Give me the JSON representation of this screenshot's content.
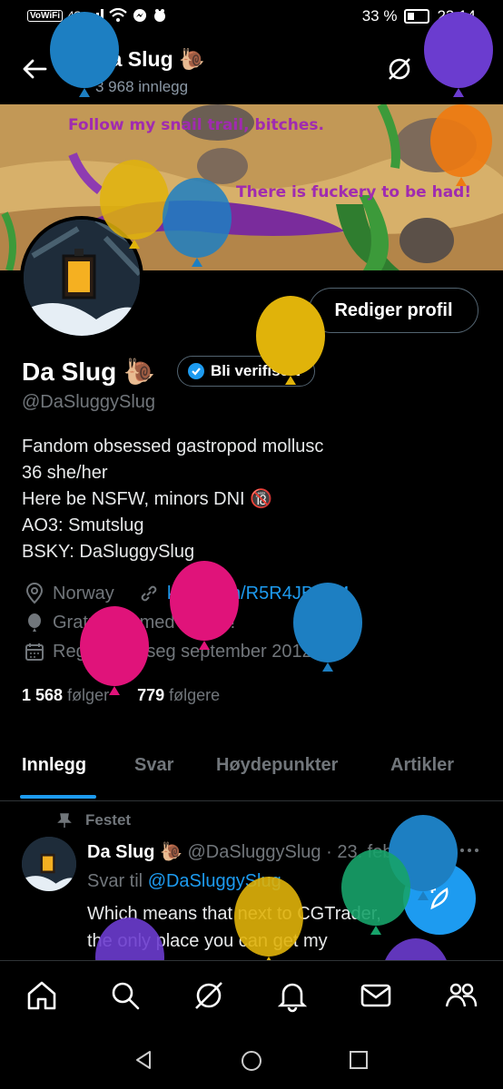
{
  "status_bar": {
    "vowifi": "VoWiFi",
    "network": "4G",
    "battery": "33 %",
    "time": "23:14"
  },
  "header": {
    "name": "Da Slug",
    "emoji": "🐌",
    "post_count": "3 968 innlegg"
  },
  "banner": {
    "text_top": "Follow my snail trail, bitches.",
    "text_bottom": "There is fuckery to be had!"
  },
  "profile": {
    "edit_label": "Rediger profil",
    "name": "Da Slug",
    "emoji": "🐌",
    "verify_label": "Bli verifisert",
    "handle": "@DaSluggySlug",
    "bio": [
      "Fandom obsessed gastropod mollusc",
      "36 she/her",
      "Here be NSFW, minors DNI 🔞",
      "AO3: Smutslug",
      "BSKY: DaSluggySlug"
    ],
    "location": "Norway",
    "website": "ko-fi.com/R5R4JBOS4",
    "birthday": "Gratulerer med dagen!",
    "joined": "Registrerte seg september 2012",
    "following_count": "1 568",
    "following_label": "følger",
    "followers_count": "779",
    "followers_label": "følgere"
  },
  "tabs": [
    "Innlegg",
    "Svar",
    "Høydepunkter",
    "Artikler"
  ],
  "tweet": {
    "pinned_label": "Festet",
    "name": "Da Slug",
    "emoji": "🐌",
    "handle": "@DaSluggySlug",
    "date": "· 23. feb.",
    "reply_prefix": "Svar til",
    "reply_to": "@DaSluggySlug",
    "body_lines": [
      "Which means that next to CGTrader,",
      "the only place you can get my"
    ]
  },
  "colors": {
    "accent": "#1d9bf0",
    "balloon_blue": "#1d7fc2",
    "balloon_yellow": "#e0b30a",
    "balloon_pink": "#e0137a",
    "balloon_purple": "#6b3ccf",
    "balloon_orange": "#f07a10",
    "balloon_green": "#17a36a"
  }
}
